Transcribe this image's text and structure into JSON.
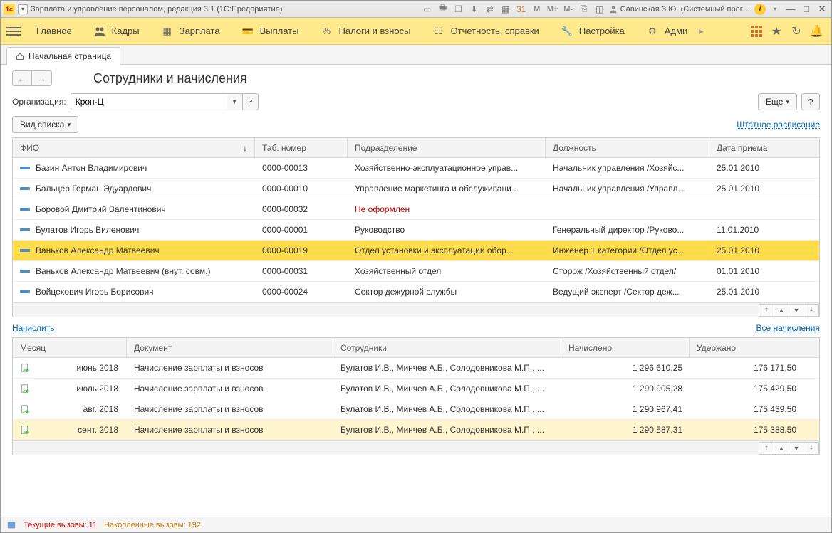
{
  "titlebar": {
    "title": "Зарплата и управление персоналом, редакция 3.1  (1С:Предприятие)",
    "user": "Савинская З.Ю. (Системный прог ..."
  },
  "nav": {
    "items": [
      {
        "label": "Главное"
      },
      {
        "label": "Кадры"
      },
      {
        "label": "Зарплата"
      },
      {
        "label": "Выплаты"
      },
      {
        "label": "Налоги и взносы"
      },
      {
        "label": "Отчетность, справки"
      },
      {
        "label": "Настройка"
      },
      {
        "label": "Адми"
      }
    ]
  },
  "tab": {
    "label": "Начальная страница"
  },
  "page": {
    "title": "Сотрудники и начисления",
    "org_label": "Организация:",
    "org_value": "Крон-Ц",
    "more": "Еще",
    "help": "?",
    "view_list": "Вид списка",
    "staff_link": "Штатное расписание",
    "accrue": "Начислить",
    "all_accruals": "Все начисления"
  },
  "table1": {
    "headers": {
      "fio": "ФИО",
      "tab": "Таб. номер",
      "dept": "Подразделение",
      "pos": "Должность",
      "date": "Дата приема"
    },
    "rows": [
      {
        "fio": "Базин Антон Владимирович",
        "tab": "0000-00013",
        "dept": "Хозяйственно-эксплуатационное управ...",
        "pos": "Начальник управления /Хозяйс...",
        "date": "25.01.2010"
      },
      {
        "fio": "Бальцер Герман Эдуардович",
        "tab": "0000-00010",
        "dept": "Управление маркетинга и обслуживани...",
        "pos": "Начальник управления /Управл...",
        "date": "25.01.2010"
      },
      {
        "fio": "Боровой Дмитрий Валентинович",
        "tab": "0000-00032",
        "dept": "Не оформлен",
        "pos": "",
        "date": "",
        "red": true
      },
      {
        "fio": "Булатов Игорь Виленович",
        "tab": "0000-00001",
        "dept": "Руководство",
        "pos": "Генеральный директор /Руково...",
        "date": "11.01.2010"
      },
      {
        "fio": "Ваньков Александр Матвеевич",
        "tab": "0000-00019",
        "dept": "Отдел установки и эксплуатации обор...",
        "pos": "Инженер 1 категории /Отдел ус...",
        "date": "25.01.2010",
        "sel": true
      },
      {
        "fio": "Ваньков Александр Матвеевич (внут. совм.)",
        "tab": "0000-00031",
        "dept": "Хозяйственный отдел",
        "pos": "Сторож /Хозяйственный отдел/",
        "date": "01.01.2010"
      },
      {
        "fio": "Войцехович Игорь Борисович",
        "tab": "0000-00024",
        "dept": "Сектор дежурной службы",
        "pos": "Ведущий эксперт /Сектор деж...",
        "date": "25.01.2010"
      }
    ]
  },
  "table2": {
    "headers": {
      "month": "Месяц",
      "doc": "Документ",
      "emp": "Сотрудники",
      "acc": "Начислено",
      "ded": "Удержано"
    },
    "rows": [
      {
        "month": "июнь 2018",
        "doc": "Начисление зарплаты и взносов",
        "emp": "Булатов И.В., Минчев А.Б., Солодовникова М.П., ...",
        "acc": "1 296 610,25",
        "ded": "176 171,50"
      },
      {
        "month": "июль 2018",
        "doc": "Начисление зарплаты и взносов",
        "emp": "Булатов И.В., Минчев А.Б., Солодовникова М.П., ...",
        "acc": "1 290 905,28",
        "ded": "175 429,50"
      },
      {
        "month": "авг. 2018",
        "doc": "Начисление зарплаты и взносов",
        "emp": "Булатов И.В., Минчев А.Б., Солодовникова М.П., ...",
        "acc": "1 290 967,41",
        "ded": "175 439,50"
      },
      {
        "month": "сент. 2018",
        "doc": "Начисление зарплаты и взносов",
        "emp": "Булатов И.В., Минчев А.Б., Солодовникова М.П., ...",
        "acc": "1 290 587,31",
        "ded": "175 388,50",
        "sel": true
      }
    ]
  },
  "status": {
    "s1": "Текущие вызовы: 11",
    "s2": "Накопленные вызовы: 192"
  }
}
